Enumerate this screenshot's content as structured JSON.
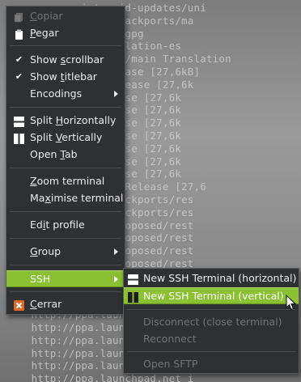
{
  "terminal_lines": [
    "         .eu intrepid-updates/uni",
    "      .eu intrepid-backports/ma",
    "      hardy Release.gpg",
    "       dy/main Translation-es",
    "        net intrepid/main Translation",
    "      net hardy Release [27,6kB]",
    "        intrepid Release [27,6k",
    "      intrepid Release [27,6k",
    "      intrepid Release [27,6k",
    "      intrepid Release [27,6k",
    "      intrepid Release [27,6k",
    "      intrepid Release [27,6k",
    "      intrepid Release [27,6k",
    "      intrepid Release [27,6k",
    "      .net intrepid Release [27,6",
    "      .u intrepid-backports/res",
    "      .u intrepid-backports/res",
    "      .u intrepid-proposed/rest",
    "      .u intrepid-proposed/rest",
    "      .u intrepid-proposed/rest",
    "      .u intrepid-proposed/rest",
    "      .net intrepid Release",
    "      Release",
    "",
    "     http://ppa.launchpad.",
    "     http://ppa.launchpad.",
    "     http://ppa.launchpad.",
    "     http://ppa.launchpad.",
    "     http://ppa.launchpad.",
    "     http://ppa.launchpad.net i"
  ],
  "context_menu": {
    "copy": {
      "pre": "",
      "u": "C",
      "post": "opiar"
    },
    "paste": {
      "pre": "",
      "u": "P",
      "post": "egar"
    },
    "show_scrollbar": {
      "pre": "Show ",
      "u": "s",
      "post": "crollbar",
      "checked": "✔"
    },
    "show_titlebar": {
      "pre": "Show ",
      "u": "t",
      "post": "itlebar",
      "checked": "✔"
    },
    "encodings": {
      "pre": "Encodings",
      "u": "",
      "post": ""
    },
    "split_horizontally": {
      "pre": "Split ",
      "u": "H",
      "post": "orizontally"
    },
    "split_vertically": {
      "pre": "Split ",
      "u": "V",
      "post": "ertically"
    },
    "open_tab": {
      "pre": "Open ",
      "u": "T",
      "post": "ab"
    },
    "zoom_terminal": {
      "pre": "",
      "u": "Z",
      "post": "oom terminal"
    },
    "maximise_terminal": {
      "pre": "Ma",
      "u": "x",
      "post": "imise terminal"
    },
    "edit_profile": {
      "pre": "Ed",
      "u": "i",
      "post": "t profile"
    },
    "group": {
      "pre": "",
      "u": "G",
      "post": "roup"
    },
    "ssh": {
      "pre": "SSH",
      "u": "",
      "post": ""
    },
    "close": {
      "pre": "",
      "u": "C",
      "post": "errar"
    }
  },
  "ssh_submenu": {
    "new_horizontal": "New SSH Terminal (horizontal)",
    "new_vertical": "New SSH Terminal (vertical)",
    "disconnect": "Disconnect (close terminal)",
    "reconnect": "Reconnect",
    "open_sftp": "Open SFTP"
  },
  "colors": {
    "menu_bg": "#2e3032",
    "highlight": "#8ac132",
    "disabled_text": "#737373",
    "close_icon": "#e0672a"
  }
}
